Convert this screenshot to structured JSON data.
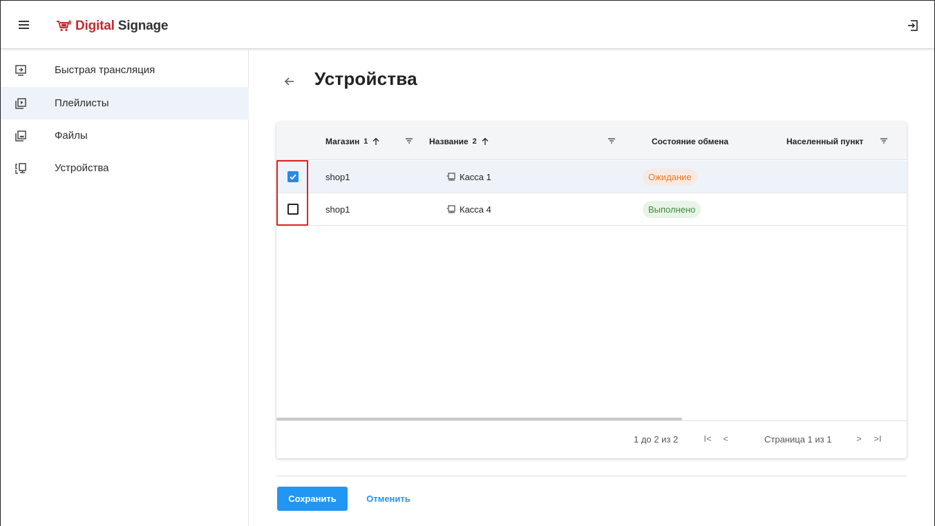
{
  "app": {
    "brand_part1": "Digital",
    "brand_part2": "Signage",
    "brand_color": "#c6282f",
    "logo_icon": "cart-signal-icon",
    "logout_icon": "logout-icon",
    "menu_icon": "hamburger-menu-icon"
  },
  "sidebar": {
    "items": [
      {
        "label": "Быстрая трансляция",
        "icon": "screen-cast-icon",
        "active": false
      },
      {
        "label": "Плейлисты",
        "icon": "playlist-play-icon",
        "active": true
      },
      {
        "label": "Файлы",
        "icon": "image-files-icon",
        "active": false
      },
      {
        "label": "Устройства",
        "icon": "devices-icon",
        "active": false
      }
    ]
  },
  "page": {
    "title": "Устройства",
    "back_icon": "arrow-left-icon"
  },
  "table": {
    "columns": [
      {
        "label": "Магазин",
        "sort_index": "1",
        "sort": "asc",
        "filter": true
      },
      {
        "label": "Название",
        "sort_index": "2",
        "sort": "asc",
        "filter": true
      },
      {
        "label": "Состояние обмена",
        "sort_index": "",
        "sort": "none",
        "filter": false
      },
      {
        "label": "Населенный пункт",
        "sort_index": "",
        "sort": "none",
        "filter": true
      }
    ],
    "rows": [
      {
        "selected": true,
        "shop": "shop1",
        "name": "Касса 1",
        "status": "Ожидание",
        "status_type": "waiting",
        "city": ""
      },
      {
        "selected": false,
        "shop": "shop1",
        "name": "Касса 4",
        "status": "Выполнено",
        "status_type": "done",
        "city": ""
      }
    ],
    "footer": {
      "range": "1 до 2 из 2",
      "page_label": "Страница 1 из 1",
      "first_glyph": "I<",
      "prev_glyph": "<",
      "next_glyph": ">",
      "last_glyph": ">I"
    },
    "status_colors": {
      "waiting_bg": "#f7eae3",
      "waiting_fg": "#e57a27",
      "done_bg": "#e8f4e7",
      "done_fg": "#3d8b3d"
    },
    "accent": "#2b8adf"
  },
  "actions": {
    "save_label": "Сохранить",
    "cancel_label": "Отменить",
    "primary_color": "#2196f3"
  }
}
